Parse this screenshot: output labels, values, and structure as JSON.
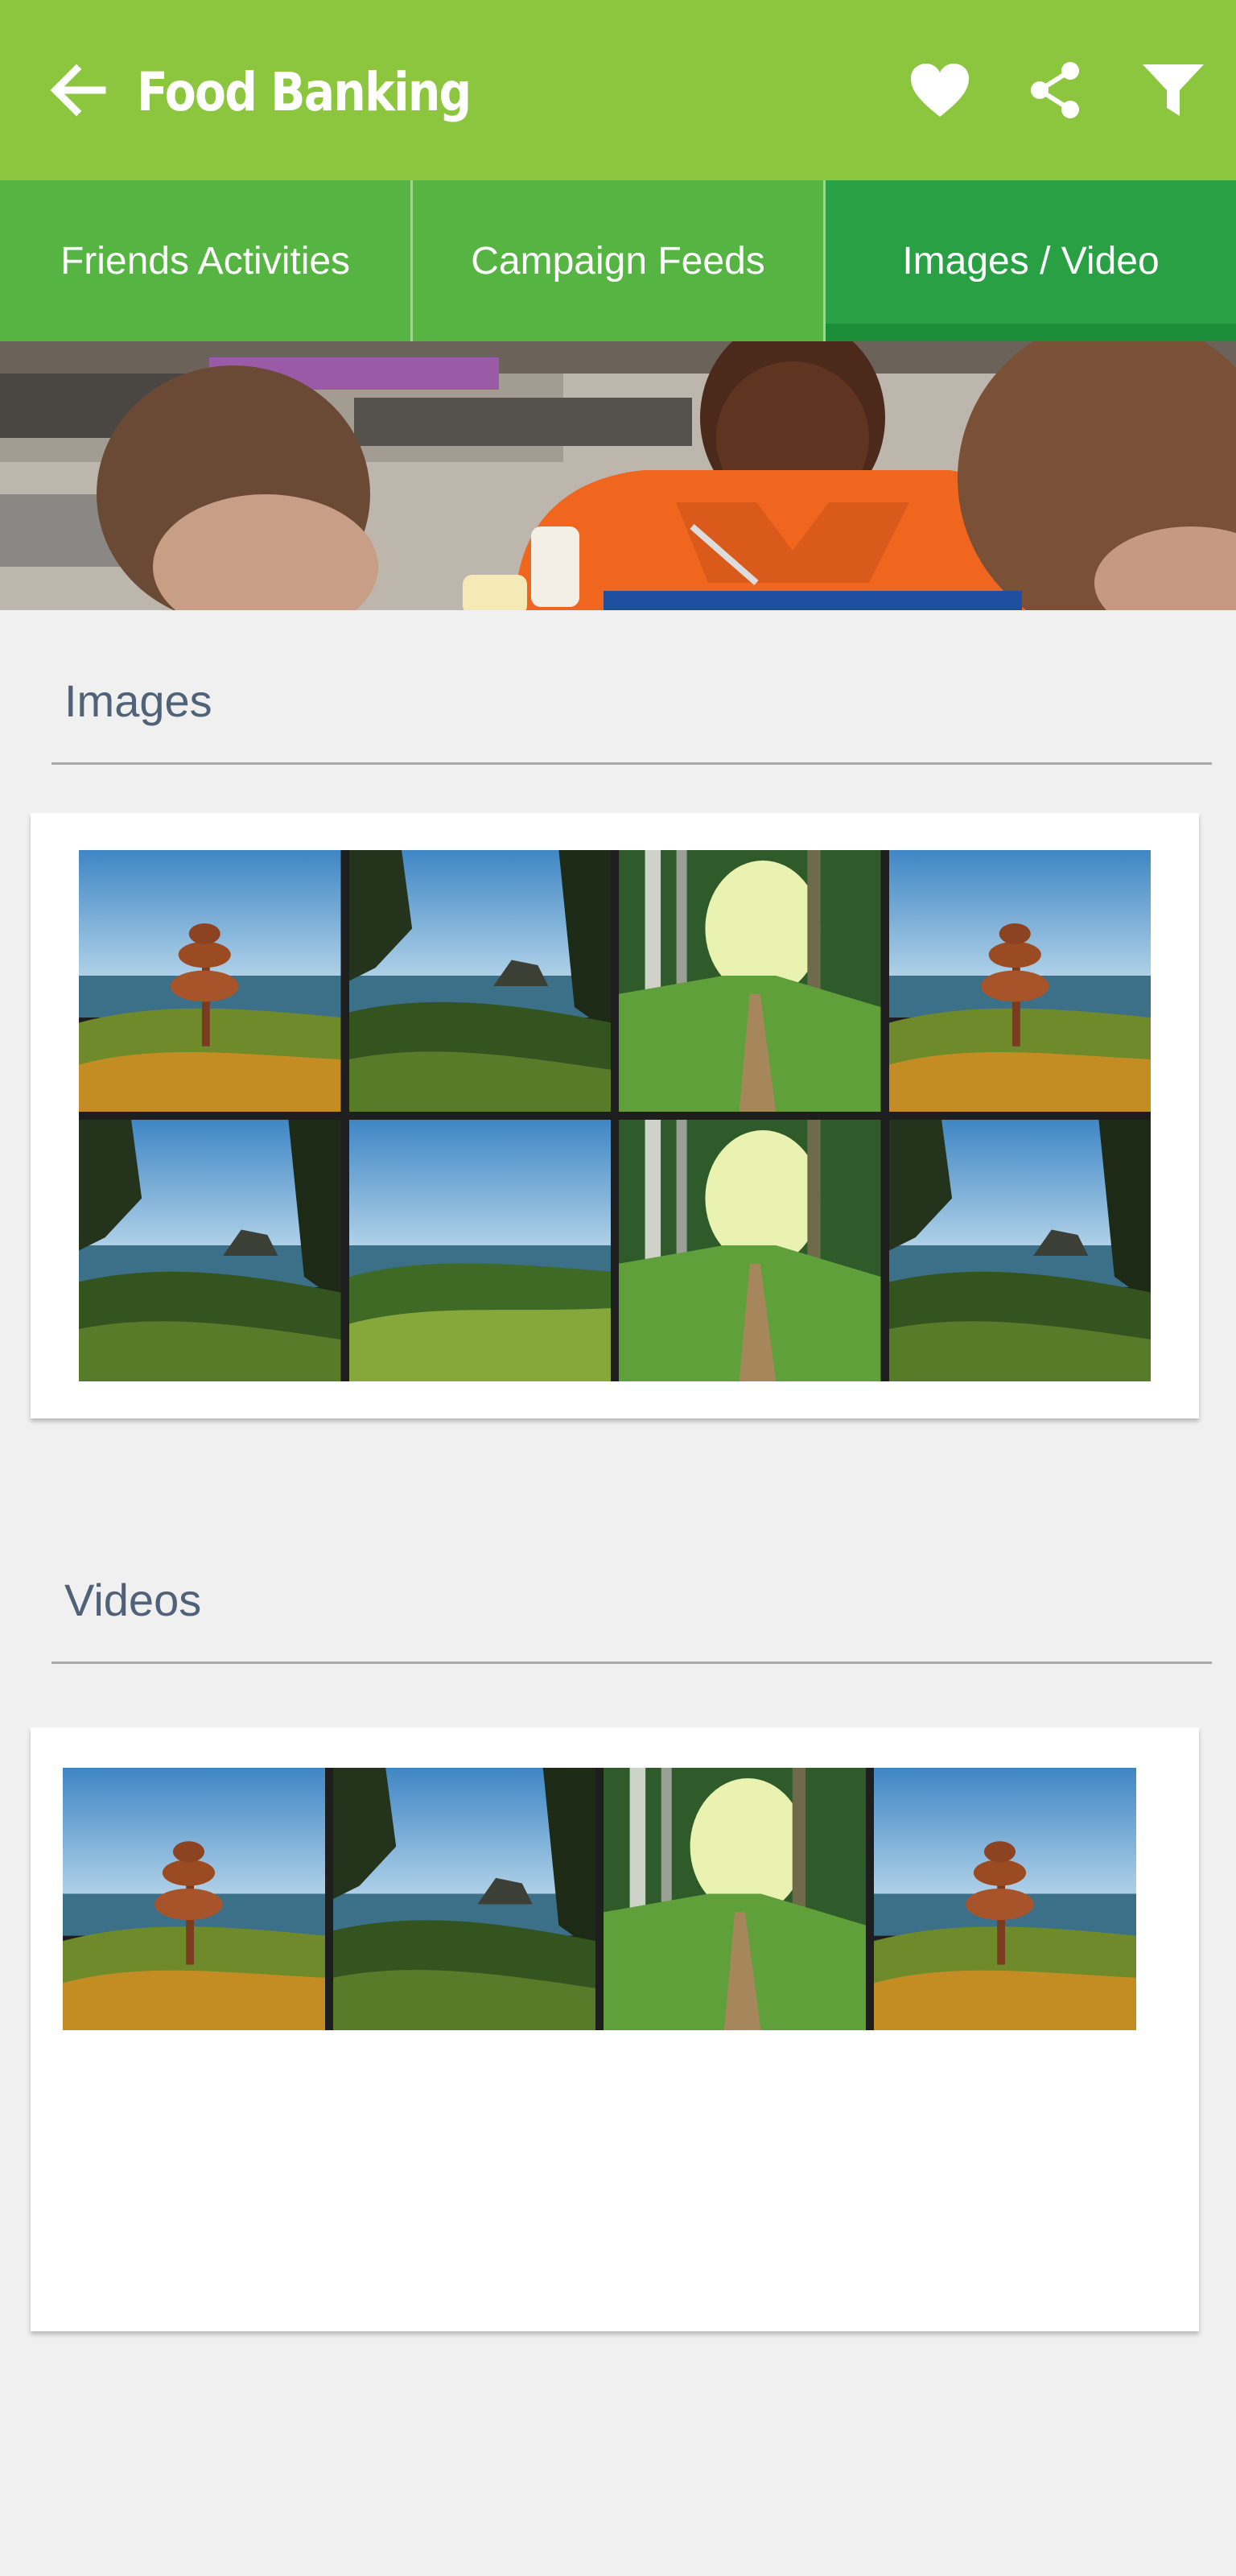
{
  "app_bar": {
    "title": "Food Banking",
    "back_icon": "arrow-left-icon",
    "actions": [
      "heart-icon",
      "share-icon",
      "filter-icon"
    ],
    "color": "#8cc63f"
  },
  "tabs": [
    {
      "label": "Friends Activities",
      "active": false
    },
    {
      "label": "Campaign Feeds",
      "active": false
    },
    {
      "label": "Images / Video",
      "active": true
    }
  ],
  "colors": {
    "tab_bg": "#56b443",
    "tab_active": "#29a044",
    "section_title": "#4f6278"
  },
  "sections": {
    "images": {
      "title": "Images",
      "thumbnails": [
        "coast-tree",
        "coast-rock",
        "forest-path",
        "coast-tree",
        "coast-rock",
        "coast-meadow",
        "forest-path",
        "coast-rock"
      ]
    },
    "videos": {
      "title": "Videos",
      "thumbnails": [
        "coast-tree",
        "coast-rock",
        "forest-path",
        "coast-tree"
      ]
    }
  }
}
